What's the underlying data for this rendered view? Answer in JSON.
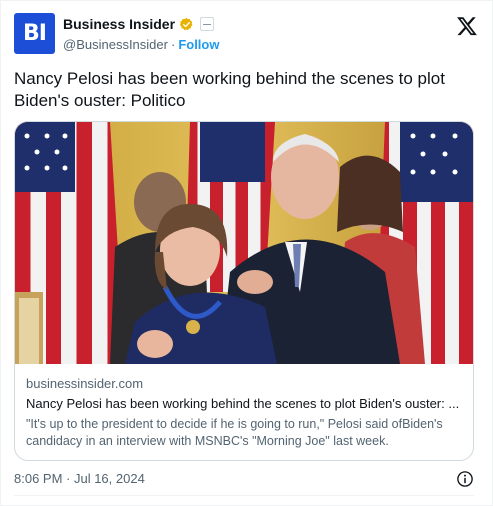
{
  "account": {
    "display_name": "Business Insider",
    "handle": "@BusinessInsider",
    "separator": "·",
    "follow_label": "Follow",
    "avatar_text": "BI",
    "avatar_color": "#1d4ed8",
    "verified_color": "#e8b200"
  },
  "tweet": {
    "text": "Nancy Pelosi has been working behind the scenes to plot Biden's ouster: Politico"
  },
  "link_card": {
    "domain": "businessinsider.com",
    "title": "Nancy Pelosi has been working behind the scenes to plot Biden's ouster: ...",
    "description": "\"It's up to the president to decide if he is going to run,\" Pelosi said ofBiden's candidacy in an interview with MSNBC's \"Morning Joe\" last week."
  },
  "footer": {
    "timestamp": "8:06 PM · Jul 16, 2024"
  },
  "icons": {
    "brand": "x-logo-icon",
    "verified": "verified-badge-icon",
    "affiliation": "affiliation-badge-icon",
    "info": "info-icon"
  },
  "colors": {
    "accent": "#1d9bf0",
    "text": "#0f1419",
    "muted": "#536471"
  }
}
